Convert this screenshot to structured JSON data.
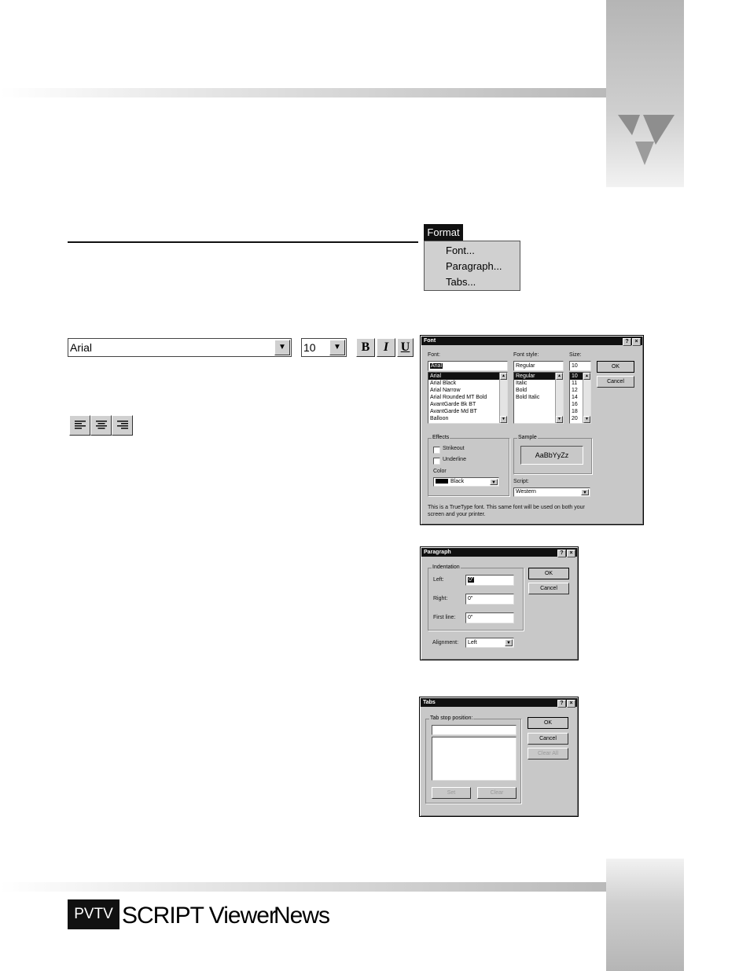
{
  "menu": {
    "title": "Format",
    "items": [
      "Font...",
      "Paragraph...",
      "Tabs..."
    ]
  },
  "toolbar": {
    "font_name": "Arial",
    "font_size": "10",
    "bold": "B",
    "italic": "I",
    "underline": "U"
  },
  "font_dialog": {
    "title": "Font",
    "help": "?",
    "close": "×",
    "font_label": "Font:",
    "font_value": "Arial",
    "fonts": [
      "Arial",
      "Arial Black",
      "Arial Narrow",
      "Arial Rounded MT Bold",
      "AvantGarde Bk BT",
      "AvantGarde Md BT",
      "Balloon"
    ],
    "style_label": "Font style:",
    "style_value": "Regular",
    "styles": [
      "Regular",
      "Italic",
      "Bold",
      "Bold Italic"
    ],
    "size_label": "Size:",
    "size_value": "10",
    "sizes": [
      "10",
      "11",
      "12",
      "14",
      "16",
      "18",
      "20"
    ],
    "ok": "OK",
    "cancel": "Cancel",
    "effects_label": "Effects",
    "strikeout": "Strikeout",
    "underline": "Underline",
    "color_label": "Color",
    "color_value": "Black",
    "sample_label": "Sample",
    "sample_text": "AaBbYyZz",
    "script_label": "Script:",
    "script_value": "Western",
    "note": "This is a TrueType font. This same font will be used on both your screen and your printer."
  },
  "paragraph_dialog": {
    "title": "Paragraph",
    "help": "?",
    "close": "×",
    "indent_label": "Indentation",
    "left_label": "Left:",
    "left_value": "0\"",
    "right_label": "Right:",
    "right_value": "0\"",
    "first_label": "First line:",
    "first_value": "0\"",
    "ok": "OK",
    "cancel": "Cancel",
    "align_label": "Alignment:",
    "align_value": "Left"
  },
  "tabs_dialog": {
    "title": "Tabs",
    "help": "?",
    "close": "×",
    "stop_label": "Tab stop position:",
    "stop_value": "",
    "ok": "OK",
    "cancel": "Cancel",
    "clear_all": "Clear All",
    "set": "Set",
    "clear": "Clear"
  },
  "footer": {
    "logo": "PVTV",
    "title": "SCRIPT Viewer",
    "section": "News"
  },
  "colors": {
    "band": "#c0c0c0",
    "dialog": "#c8c8c8",
    "titlebar": "#101010"
  }
}
